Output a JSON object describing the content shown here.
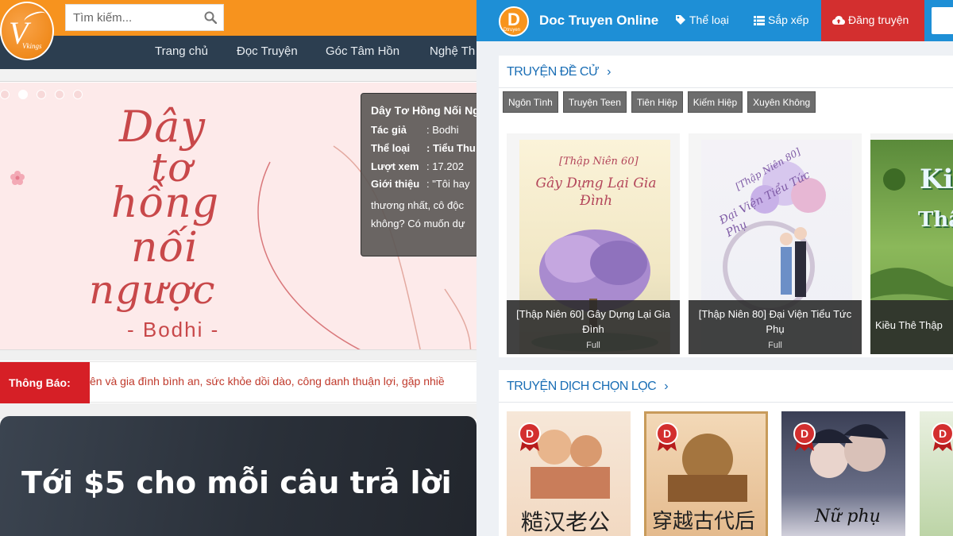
{
  "left": {
    "logo": {
      "letter": "V",
      "text": "Vkings"
    },
    "search": {
      "placeholder": "Tìm kiếm..."
    },
    "nav": [
      "Trang chủ",
      "Đọc Truyện",
      "Góc Tâm Hồn",
      "Nghệ Th"
    ],
    "banner": {
      "title_lines": [
        "Dây",
        "tơ",
        "hồng",
        "nối",
        "ngược"
      ],
      "author_line": "- Bodhi -",
      "slide_count": 5,
      "active_slide": 1
    },
    "popup": {
      "title": "Dây Tơ Hồng Nối Ng",
      "rows": [
        {
          "key": "Tác giả",
          "value": ": Bodhi",
          "bold": false
        },
        {
          "key": "Thể loại",
          "value": ": Tiểu Thu",
          "bold": true
        },
        {
          "key": "Lượt xem",
          "value": ": 17.202",
          "bold": false
        },
        {
          "key": "Giới thiệu",
          "value": ": \"Tôi hay",
          "bold": false
        }
      ],
      "desc_lines": [
        "thương nhất, cô độc",
        "không? Có muốn dự"
      ]
    },
    "notice": {
      "label": "Thông Báo:",
      "text": "ên và gia đình bình an, sức khỏe dồi dào, công danh thuận lợi, gặp nhiề"
    },
    "promo": {
      "text": "Tới $5 cho mỗi câu trả lời"
    }
  },
  "right": {
    "header": {
      "logo_letter": "D",
      "logo_sub": "Dtruyen",
      "brand": "Doc Truyen Online",
      "menu": [
        {
          "label": "Thể loại",
          "icon": "tag-icon"
        },
        {
          "label": "Sắp xếp",
          "icon": "list-icon"
        }
      ],
      "upload_label": "Đăng truyện"
    },
    "recommended": {
      "title": "TRUYỆN ĐỀ CỬ",
      "chevron": "›",
      "tags": [
        "Ngôn Tình",
        "Truyện Teen",
        "Tiên Hiệp",
        "Kiếm Hiệp",
        "Xuyên Không"
      ],
      "cards": [
        {
          "cover_text_top": "[Thập Niên 60]",
          "cover_text_main": "Gây Dựng Lại Gia Đình",
          "title": "[Thập Niên 60] Gây Dựng Lại Gia Đình",
          "status": "Full"
        },
        {
          "cover_text_top": "[Thập Niên 80]",
          "cover_text_main": "Đại Viện Tiểu Tức Phụ",
          "title": "[Thập Niên 80] Đại Viện Tiểu Tức Phụ",
          "status": "Full"
        },
        {
          "cover_text_top": "Kiều",
          "cover_text_main": "Thập N",
          "title": "Kiều Thê Thập",
          "status": ""
        }
      ]
    },
    "translated": {
      "title": "TRUYỆN DỊCH CHỌN LỌC",
      "chevron": "›",
      "badge_letter": "D",
      "thumbs": [
        {
          "cover_text": "糙汉老公"
        },
        {
          "cover_text": "穿越古代后"
        },
        {
          "cover_text": "Nữ phụ"
        },
        {
          "cover_text": ""
        }
      ]
    },
    "colors": {
      "header": "#1e8fd6",
      "upload": "#d32f2f",
      "section_title": "#1a6eb5",
      "badge": "#d32f2f"
    }
  }
}
